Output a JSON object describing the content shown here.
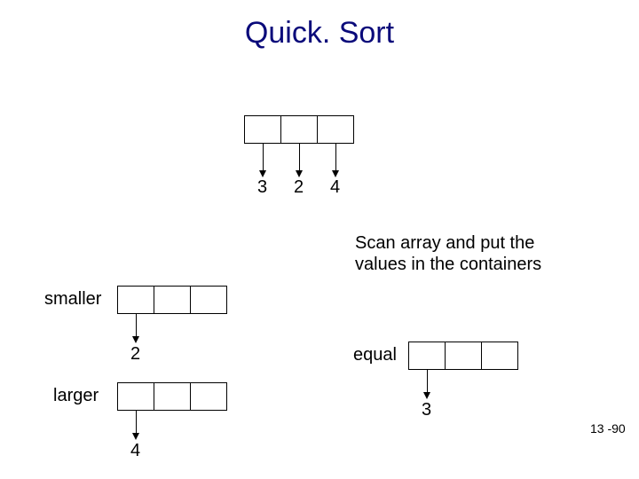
{
  "title": "Quick. Sort",
  "top_values": [
    "3",
    "2",
    "4"
  ],
  "caption_line1": "Scan array and put the",
  "caption_line2": "values in the containers",
  "labels": {
    "smaller": "smaller",
    "larger": "larger",
    "equal": "equal"
  },
  "bucket_values": {
    "smaller": "2",
    "larger": "4",
    "equal": "3"
  },
  "page_number": "13 -90"
}
